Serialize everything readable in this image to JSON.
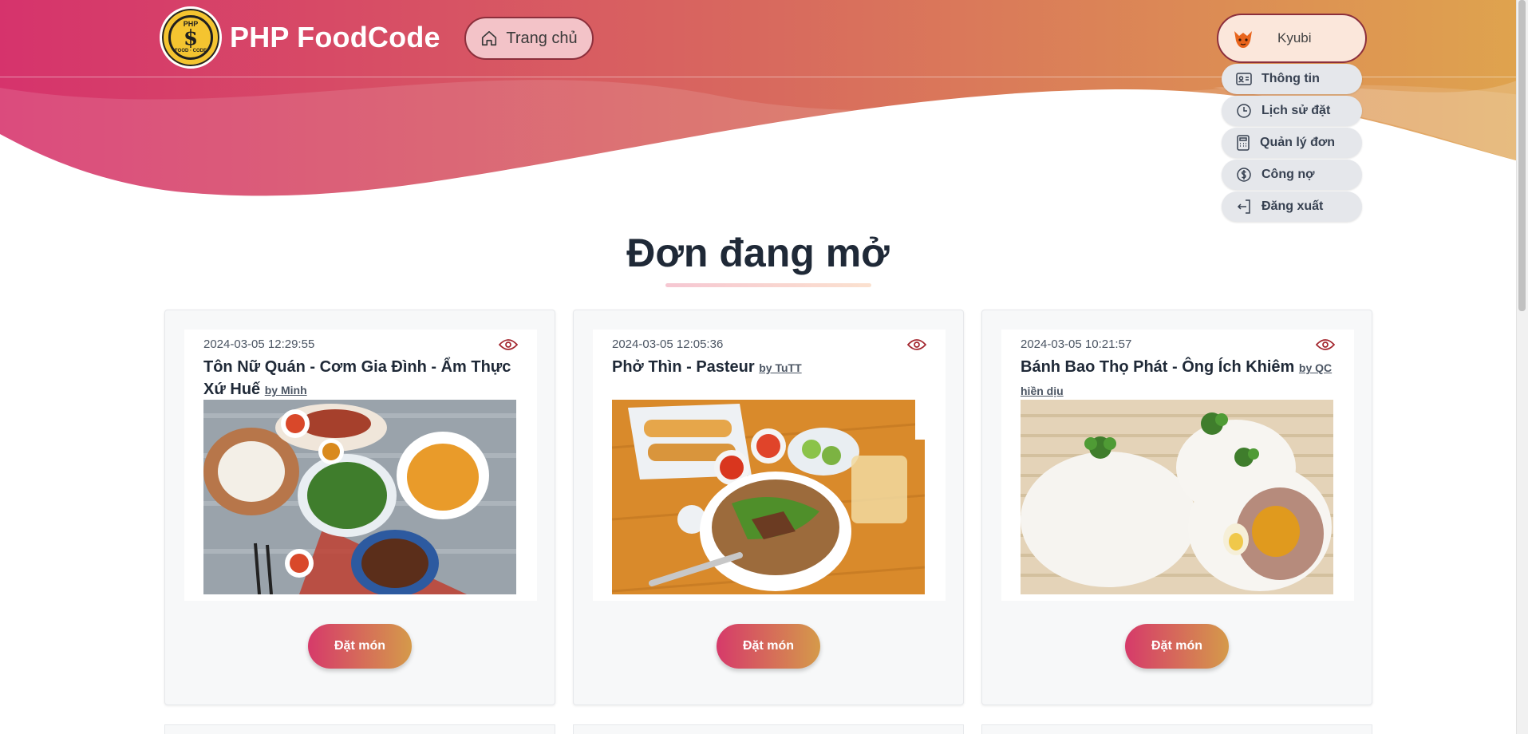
{
  "header": {
    "brand_title": "PHP FoodCode",
    "logo": {
      "top_text": "PHP",
      "symbol": "$",
      "bottom_text": "FOOD · CODE"
    },
    "home_button_label": "Trang chủ",
    "user_name": "Kyubi",
    "user_menu": [
      {
        "label": "Thông tin",
        "icon": "id-card-icon"
      },
      {
        "label": "Lịch sử đặt",
        "icon": "clock-icon"
      },
      {
        "label": "Quản lý đơn",
        "icon": "calculator-icon"
      },
      {
        "label": "Công nợ",
        "icon": "dollar-icon"
      },
      {
        "label": "Đăng xuất",
        "icon": "logout-icon"
      }
    ]
  },
  "main": {
    "section_title": "Đơn đang mở",
    "order_button_label": "Đặt món",
    "cards": [
      {
        "date": "2024-03-05 12:29:55",
        "title": "Tôn Nữ Quán - Cơm Gia Đình - Ẩm Thực Xứ Huế",
        "by": "by Minh"
      },
      {
        "date": "2024-03-05 12:05:36",
        "title": "Phở Thìn - Pasteur",
        "by": "by TuTT"
      },
      {
        "date": "2024-03-05 10:21:57",
        "title": "Bánh Bao Thọ Phát - Ông Ích Khiêm",
        "by": "by QC hiền dịu"
      }
    ]
  },
  "colors": {
    "hero_left": "#d6336c",
    "hero_right": "#dfa44e",
    "accent": "#8c2f3c",
    "button_gradient_start": "#d63a6a",
    "button_gradient_end": "#d59a4a"
  }
}
